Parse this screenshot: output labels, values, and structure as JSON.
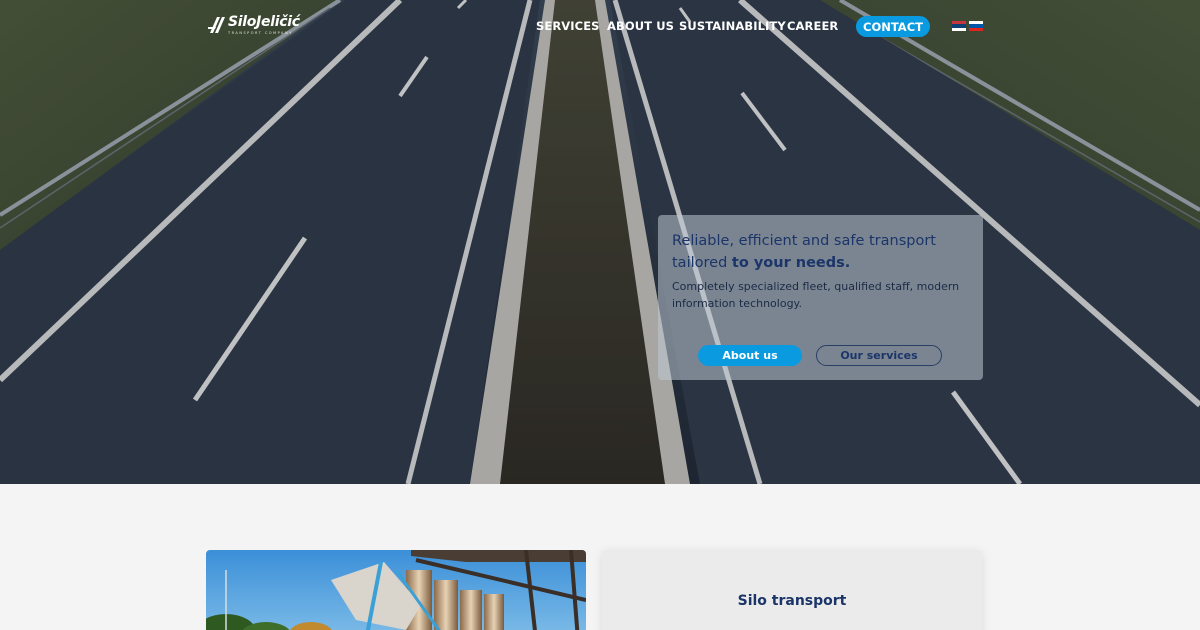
{
  "brand": {
    "name": "SiloJeličić",
    "tagline": "TRANSPORT COMPANY"
  },
  "nav": {
    "items": [
      {
        "label": "SERVICES"
      },
      {
        "label": "ABOUT US"
      },
      {
        "label": "SUSTAINABILITY"
      },
      {
        "label": "CAREER"
      }
    ],
    "contact_label": "CONTACT",
    "languages": [
      {
        "name": "Serbian",
        "icon": "serbia-flag-icon"
      },
      {
        "name": "Slovenian",
        "icon": "slovenia-flag-icon"
      }
    ]
  },
  "hero": {
    "title_part1": "Reliable, efficient and safe transport tailored",
    "title_part2": "to your needs.",
    "subtitle": "Completely specialized fleet, qualified staff, modern information technology.",
    "primary_button": "About us",
    "secondary_button": "Our services"
  },
  "services": {
    "first_card_title": "Silo transport"
  },
  "colors": {
    "accent": "#0a9ae0",
    "navy": "#1b3569",
    "page_bg": "#f4f4f4"
  }
}
